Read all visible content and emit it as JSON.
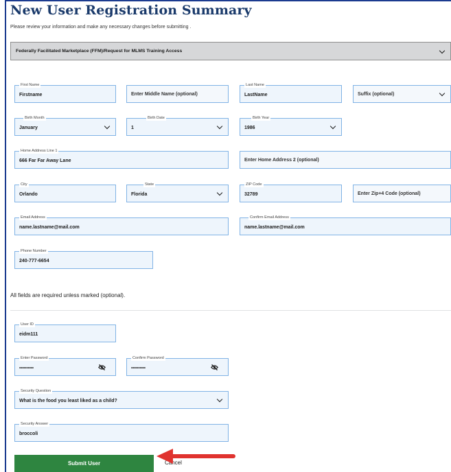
{
  "page": {
    "title": "New User Registration Summary",
    "subtitle": "Please review your information and make any necessary changes before submitting ."
  },
  "access_type": {
    "value": "Federally Facilitated Marketplace (FFM)/Request for MLMS Training Access"
  },
  "fields": {
    "first_name": {
      "label": "First Name",
      "value": "Firstname"
    },
    "middle_name": {
      "placeholder": "Enter Middle Name (optional)"
    },
    "last_name": {
      "label": "Last Name",
      "value": "LastName"
    },
    "suffix": {
      "placeholder": "Suffix (optional)"
    },
    "birth_month": {
      "label": "Birth Month",
      "value": "January"
    },
    "birth_date": {
      "label": "Birth Date",
      "value": "1"
    },
    "birth_year": {
      "label": "Birth Year",
      "value": "1986"
    },
    "address1": {
      "label": "Home Address Line 1",
      "value": "666 Far Far Away Lane"
    },
    "address2": {
      "placeholder": "Enter Home Address 2 (optional)"
    },
    "city": {
      "label": "City",
      "value": "Orlando"
    },
    "state": {
      "label": "State",
      "value": "Florida"
    },
    "zip": {
      "label": "ZIP Code",
      "value": "32789"
    },
    "zip4": {
      "placeholder": "Enter Zip+4 Code (optional)"
    },
    "email": {
      "label": "Email Address",
      "value": "name.lastname@mail.com"
    },
    "confirm_email": {
      "label": "Confirm Email Address",
      "value": "name.lastname@mail.com"
    },
    "phone": {
      "label": "Phone Number",
      "value": "240-777-6654"
    },
    "user_id": {
      "label": "User ID",
      "value": "eidm111"
    },
    "password": {
      "label": "Enter Password",
      "value": "••••••••••"
    },
    "confirm_password": {
      "label": "Confirm Password",
      "value": "••••••••••"
    },
    "security_question": {
      "label": "Security Question",
      "value": "What is the food you least liked as a child?"
    },
    "security_answer": {
      "label": "Security Answer",
      "value": "broccoli"
    }
  },
  "required_note": "All fields are required unless marked (optional).",
  "actions": {
    "submit_label": "Submit User",
    "cancel_label": "Cancel"
  },
  "colors": {
    "primary_blue": "#1a3a6b",
    "field_border": "#7fb2e5",
    "submit_green": "#2e8540",
    "annotation_arrow": "#e0332f"
  },
  "icons": {
    "password_toggle": "eye-slash-icon",
    "select_arrow": "chevron-down-icon",
    "annotation": "red-arrow-icon"
  }
}
